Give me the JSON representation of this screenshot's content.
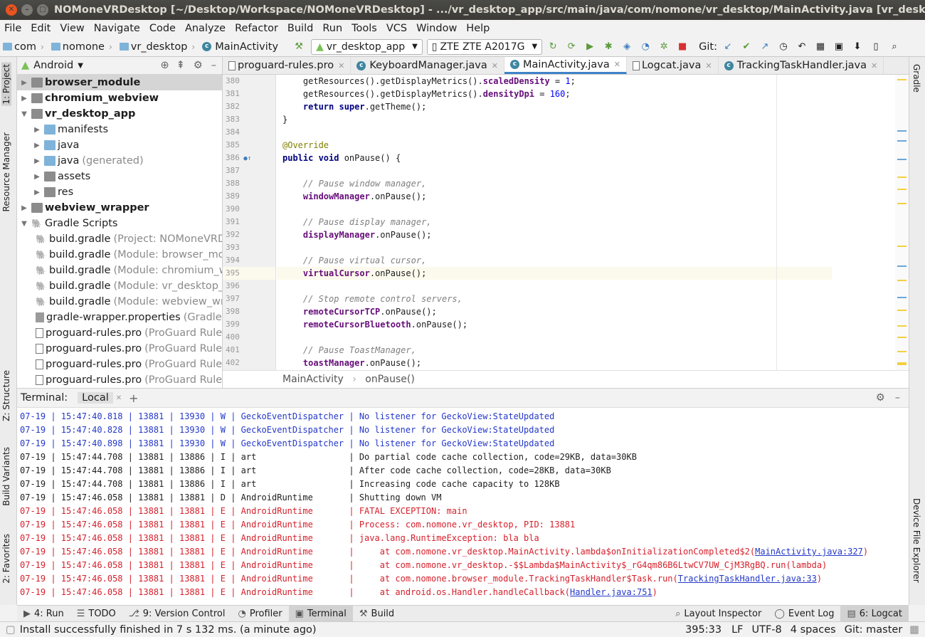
{
  "window": {
    "title": "NOMoneVRDesktop [~/Desktop/Workspace/NOMoneVRDesktop] - .../vr_desktop_app/src/main/java/com/nomone/vr_desktop/MainActivity.java [vr_desktop_ap"
  },
  "menu": [
    "File",
    "Edit",
    "View",
    "Navigate",
    "Code",
    "Analyze",
    "Refactor",
    "Build",
    "Run",
    "Tools",
    "VCS",
    "Window",
    "Help"
  ],
  "nav": {
    "crumbs": [
      "com",
      "nomone",
      "vr_desktop",
      "MainActivity"
    ],
    "run_config": "vr_desktop_app",
    "device": "ZTE ZTE A2017G",
    "git_label": "Git:"
  },
  "left_tabs": [
    "1: Project",
    "Resource Manager",
    "Z: Structure",
    "Build Variants",
    "2: Favorites"
  ],
  "right_tabs": [
    "Gradle",
    "Device File Explorer"
  ],
  "project": {
    "view": "Android",
    "tree": [
      {
        "indent": 0,
        "arrow": "▶",
        "icon": "mod",
        "name": "browser_module",
        "bold": true,
        "sel": true
      },
      {
        "indent": 0,
        "arrow": "▶",
        "icon": "mod",
        "name": "chromium_webview",
        "bold": true
      },
      {
        "indent": 0,
        "arrow": "▼",
        "icon": "mod",
        "name": "vr_desktop_app",
        "bold": true
      },
      {
        "indent": 1,
        "arrow": "▶",
        "icon": "folder",
        "name": "manifests"
      },
      {
        "indent": 1,
        "arrow": "▶",
        "icon": "folder",
        "name": "java"
      },
      {
        "indent": 1,
        "arrow": "▶",
        "icon": "folder",
        "name": "java",
        "extra": "(generated)"
      },
      {
        "indent": 1,
        "arrow": "▶",
        "icon": "mod",
        "name": "assets"
      },
      {
        "indent": 1,
        "arrow": "▶",
        "icon": "mod",
        "name": "res"
      },
      {
        "indent": 0,
        "arrow": "▶",
        "icon": "mod",
        "name": "webview_wrapper",
        "bold": true
      },
      {
        "indent": 0,
        "arrow": "▼",
        "icon": "gradle",
        "name": "Gradle Scripts"
      },
      {
        "indent": 1,
        "arrow": "",
        "icon": "gradle",
        "name": "build.gradle",
        "extra": "(Project: NOMoneVRDesktop)"
      },
      {
        "indent": 1,
        "arrow": "",
        "icon": "gradle",
        "name": "build.gradle",
        "extra": "(Module: browser_module)"
      },
      {
        "indent": 1,
        "arrow": "",
        "icon": "gradle",
        "name": "build.gradle",
        "extra": "(Module: chromium_webview)"
      },
      {
        "indent": 1,
        "arrow": "",
        "icon": "gradle",
        "name": "build.gradle",
        "extra": "(Module: vr_desktop_app)"
      },
      {
        "indent": 1,
        "arrow": "",
        "icon": "gradle",
        "name": "build.gradle",
        "extra": "(Module: webview_wrapper)"
      },
      {
        "indent": 1,
        "arrow": "",
        "icon": "props",
        "name": "gradle-wrapper.properties",
        "extra": "(Gradle Version)"
      },
      {
        "indent": 1,
        "arrow": "",
        "icon": "file",
        "name": "proguard-rules.pro",
        "extra": "(ProGuard Rules)"
      },
      {
        "indent": 1,
        "arrow": "",
        "icon": "file",
        "name": "proguard-rules.pro",
        "extra": "(ProGuard Rules)"
      },
      {
        "indent": 1,
        "arrow": "",
        "icon": "file",
        "name": "proguard-rules.pro",
        "extra": "(ProGuard Rules)"
      },
      {
        "indent": 1,
        "arrow": "",
        "icon": "file",
        "name": "proguard-rules.pro",
        "extra": "(ProGuard Rules)"
      }
    ]
  },
  "editor_tabs": [
    {
      "name": "proguard-rules.pro",
      "icon": "file"
    },
    {
      "name": "KeyboardManager.java",
      "icon": "class"
    },
    {
      "name": "MainActivity.java",
      "icon": "class",
      "active": true
    },
    {
      "name": "Logcat.java",
      "icon": "file"
    },
    {
      "name": "TrackingTaskHandler.java",
      "icon": "class"
    }
  ],
  "code": {
    "line_numbers": [
      "380",
      "381",
      "382",
      "383",
      "384",
      "385",
      "386",
      "387",
      "388",
      "389",
      "390",
      "391",
      "392",
      "393",
      "394",
      "395",
      "396",
      "397",
      "398",
      "399",
      "400",
      "401",
      "402"
    ],
    "highlight_index": 15,
    "breadcrumb": [
      "MainActivity",
      "onPause()"
    ]
  },
  "terminal": {
    "title": "Terminal:",
    "tab": "Local",
    "lines": [
      {
        "lvl": "W",
        "text": "07-19 | 15:47:40.818 | 13881 | 13930 | W | GeckoEventDispatcher | No listener for GeckoView:StateUpdated"
      },
      {
        "lvl": "W",
        "text": "07-19 | 15:47:40.828 | 13881 | 13930 | W | GeckoEventDispatcher | No listener for GeckoView:StateUpdated"
      },
      {
        "lvl": "W",
        "text": "07-19 | 15:47:40.898 | 13881 | 13930 | W | GeckoEventDispatcher | No listener for GeckoView:StateUpdated"
      },
      {
        "lvl": "I",
        "text": "07-19 | 15:47:44.708 | 13881 | 13886 | I | art                  | Do partial code cache collection, code=29KB, data=30KB"
      },
      {
        "lvl": "I",
        "text": "07-19 | 15:47:44.708 | 13881 | 13886 | I | art                  | After code cache collection, code=28KB, data=30KB"
      },
      {
        "lvl": "I",
        "text": "07-19 | 15:47:44.708 | 13881 | 13886 | I | art                  | Increasing code cache capacity to 128KB"
      },
      {
        "lvl": "D",
        "text": "07-19 | 15:47:46.058 | 13881 | 13881 | D | AndroidRuntime       | Shutting down VM"
      },
      {
        "lvl": "E",
        "text": "07-19 | 15:47:46.058 | 13881 | 13881 | E | AndroidRuntime       | FATAL EXCEPTION: main"
      },
      {
        "lvl": "E",
        "text": "07-19 | 15:47:46.058 | 13881 | 13881 | E | AndroidRuntime       | Process: com.nomone.vr_desktop, PID: 13881"
      },
      {
        "lvl": "E",
        "text": "07-19 | 15:47:46.058 | 13881 | 13881 | E | AndroidRuntime       | java.lang.RuntimeException: bla bla"
      },
      {
        "lvl": "E",
        "text": "07-19 | 15:47:46.058 | 13881 | 13881 | E | AndroidRuntime       |     at com.nomone.vr_desktop.MainActivity.lambda$onInitializationCompleted$2(",
        "link": "MainActivity.java:327",
        "tail": ")"
      },
      {
        "lvl": "E",
        "text": "07-19 | 15:47:46.058 | 13881 | 13881 | E | AndroidRuntime       |     at com.nomone.vr_desktop.-$$Lambda$MainActivity$_rG4qm86B6LtwCV7UW_CjM3RgBQ.run(lambda)"
      },
      {
        "lvl": "E",
        "text": "07-19 | 15:47:46.058 | 13881 | 13881 | E | AndroidRuntime       |     at com.nomone.browser_module.TrackingTaskHandler$Task.run(",
        "link": "TrackingTaskHandler.java:33",
        "tail": ")"
      },
      {
        "lvl": "E",
        "text": "07-19 | 15:47:46.058 | 13881 | 13881 | E | AndroidRuntime       |     at android.os.Handler.handleCallback(",
        "link": "Handler.java:751",
        "tail": ")"
      }
    ]
  },
  "bottom_tools": {
    "left": [
      {
        "id": "run",
        "icon": "▶",
        "label": "4: Run"
      },
      {
        "id": "todo",
        "icon": "☰",
        "label": "TODO"
      },
      {
        "id": "vc",
        "icon": "⎇",
        "label": "9: Version Control"
      },
      {
        "id": "profiler",
        "icon": "◔",
        "label": "Profiler"
      },
      {
        "id": "terminal",
        "icon": "▣",
        "label": "Terminal",
        "on": true
      },
      {
        "id": "build",
        "icon": "⚒",
        "label": "Build"
      }
    ],
    "right": [
      {
        "id": "layout",
        "icon": "⌕",
        "label": "Layout Inspector"
      },
      {
        "id": "eventlog",
        "icon": "◯",
        "label": "Event Log"
      },
      {
        "id": "logcat",
        "icon": "▤",
        "label": "6: Logcat",
        "on": true
      }
    ]
  },
  "status": {
    "message": "Install successfully finished in 7 s 132 ms. (a minute ago)",
    "position": "395:33",
    "line_sep": "LF",
    "encoding": "UTF-8",
    "indent": "4 spaces",
    "git": "Git: master"
  }
}
